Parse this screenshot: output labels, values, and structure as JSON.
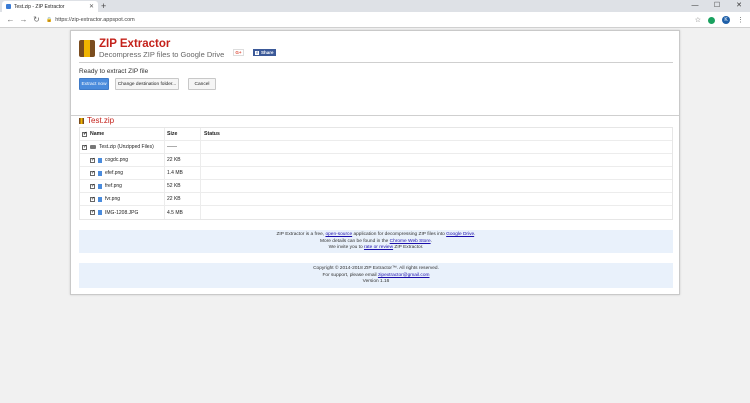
{
  "browser": {
    "tab_title": "Test.zip - ZIP Extractor",
    "new_tab": "+",
    "url": "https://zip-extractor.appspot.com",
    "avatar_letter": "K"
  },
  "header": {
    "brand": "ZIP Extractor",
    "tagline": "Decompress ZIP files to Google Drive",
    "gplus": "G+",
    "share": "Share"
  },
  "actions": {
    "status": "Ready to extract ZIP file",
    "extract": "Extract now",
    "change_dest": "Change destination folder...",
    "cancel": "Cancel"
  },
  "file": {
    "name": "Test.zip",
    "columns": {
      "name": "Name",
      "size": "Size",
      "status": "Status"
    },
    "folder": {
      "name": "Test.zip (Unzipped Files)",
      "size": "——"
    },
    "entries": [
      {
        "name": "cogdc.png",
        "size": "22 KB"
      },
      {
        "name": "efef.png",
        "size": "1.4 MB"
      },
      {
        "name": "fref.png",
        "size": "52 KB"
      },
      {
        "name": "fvr.png",
        "size": "22 KB"
      },
      {
        "name": "IMG-1208.JPG",
        "size": "4.5 MB"
      }
    ]
  },
  "info": {
    "l1_pre": "ZIP Extractor is a free, ",
    "l1_link1": "open-source",
    "l1_mid": " application for decompressing ZIP files into ",
    "l1_link2": "Google Drive",
    "l1_post": ".",
    "l2_pre": "More details can be found in the ",
    "l2_link": "Chrome Web Store",
    "l2_post": ".",
    "l3_pre": "We invite you to ",
    "l3_link": "rate or review",
    "l3_post": " ZIP Extractor."
  },
  "footer": {
    "copyright": "Copyright © 2014-2018 ZIP Extractor™. All rights reserved.",
    "support_pre": "For support, please email ",
    "support_email": "zipextractor@gmail.com",
    "version": "Version 1.16"
  },
  "colors": {
    "brand": "#c4211a",
    "primary": "#4a8bdc",
    "info_bg": "#e9f1fb"
  }
}
